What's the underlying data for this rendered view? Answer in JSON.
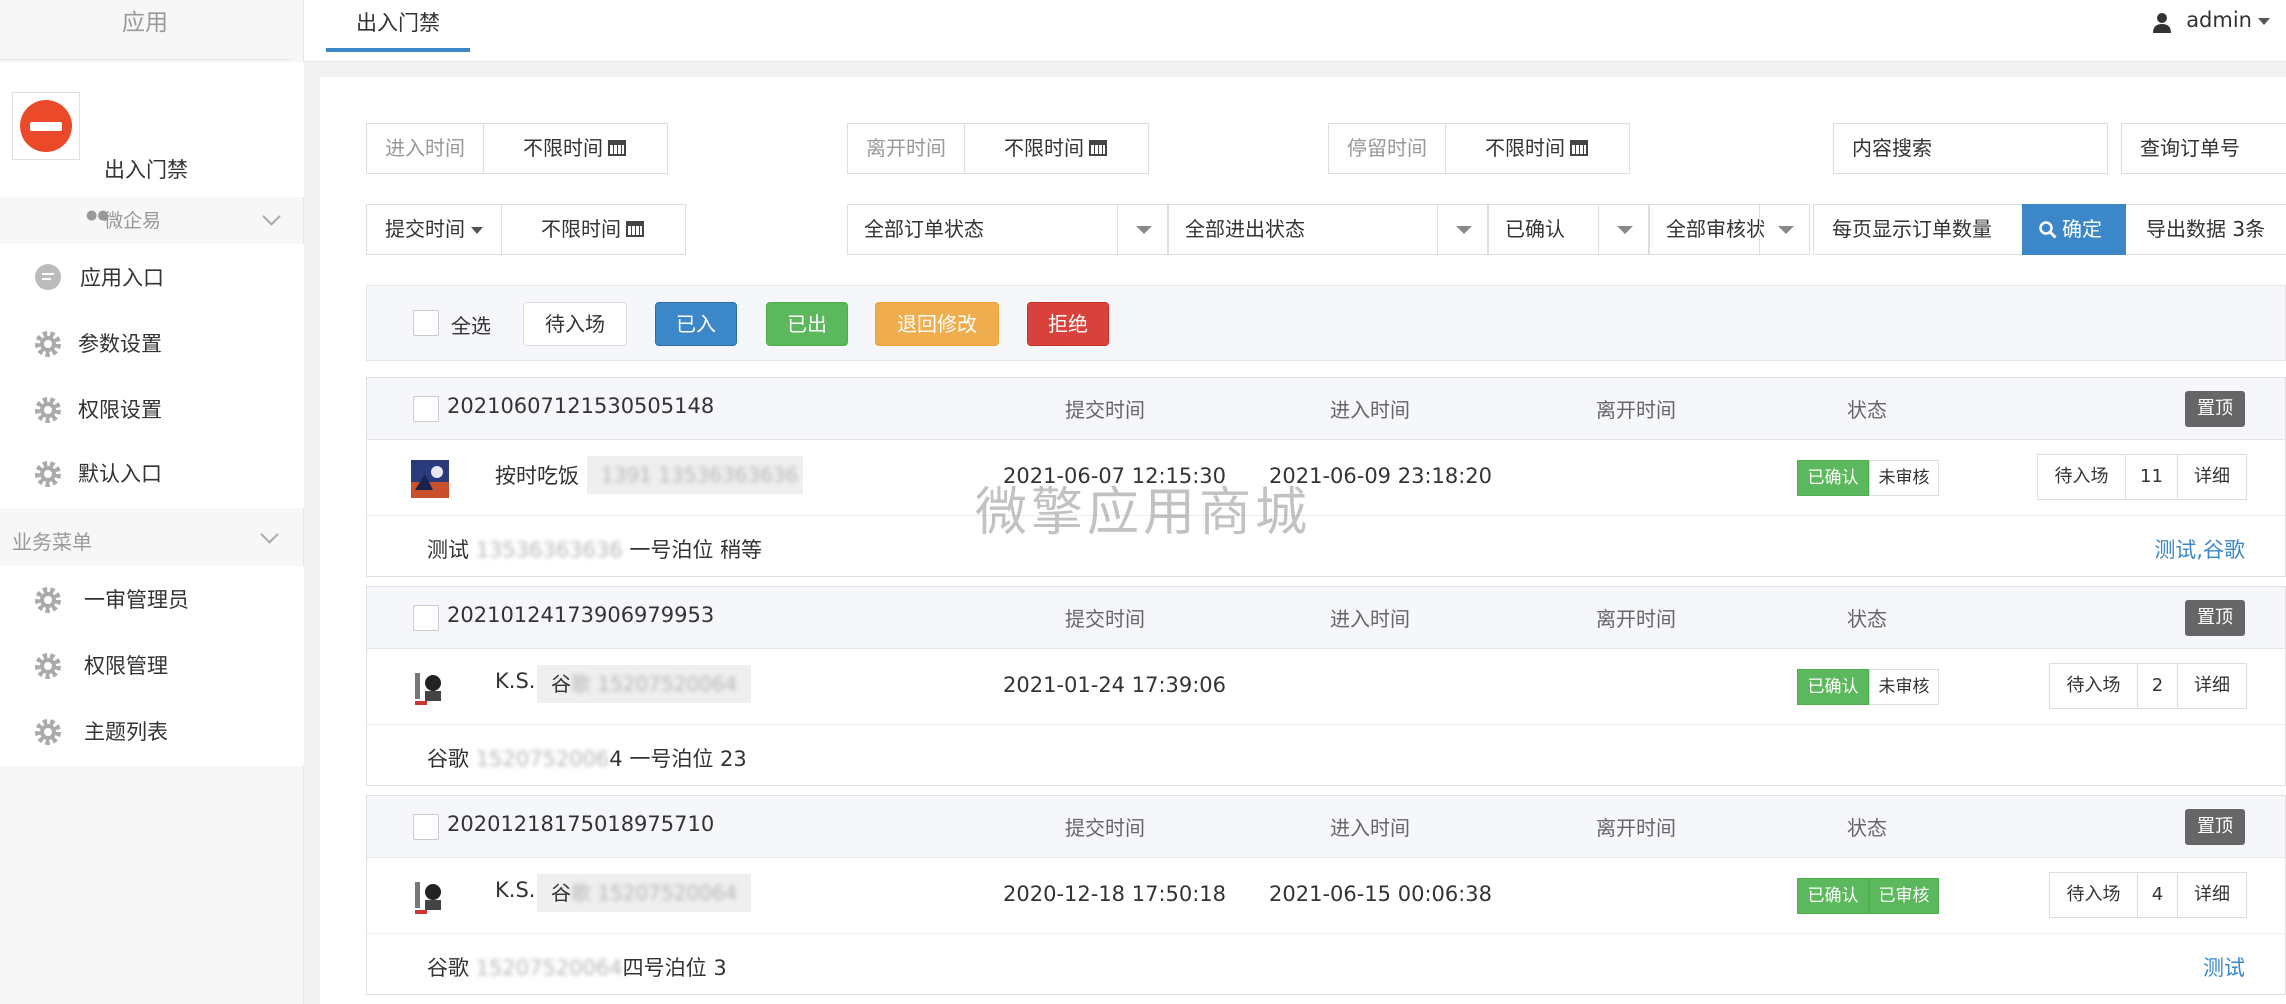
{
  "sidebar": {
    "title": "应用",
    "module": {
      "name": "出入门禁",
      "logo_icon": "no-entry-icon"
    },
    "group1": {
      "label": "微企易"
    },
    "group1_items": [
      {
        "label": "应用入口",
        "icon": "chat-bubble-icon"
      },
      {
        "label": "参数设置",
        "icon": "gear-icon"
      },
      {
        "label": "权限设置",
        "icon": "gear-icon"
      },
      {
        "label": "默认入口",
        "icon": "gear-icon"
      }
    ],
    "group2": {
      "label": "业务菜单"
    },
    "group2_items": [
      {
        "label": "一审管理员",
        "icon": "gear-icon"
      },
      {
        "label": "权限管理",
        "icon": "gear-icon"
      },
      {
        "label": "主题列表",
        "icon": "gear-icon"
      }
    ]
  },
  "topbar": {
    "tab": "出入门禁",
    "user": "admin"
  },
  "filters": {
    "enter_time": {
      "label": "进入时间",
      "value": "不限时间"
    },
    "leave_time": {
      "label": "离开时间",
      "value": "不限时间"
    },
    "stay_time": {
      "label": "停留时间",
      "value": "不限时间"
    },
    "content_search_placeholder": "内容搜索",
    "order_search_placeholder": "查询订单号",
    "submit_time": {
      "label": "提交时间",
      "value": "不限时间"
    },
    "order_status": "全部订单状态",
    "inout_status": "全部进出状态",
    "confirm_status": "已确认",
    "review_status": "全部审核状态",
    "page_size_placeholder": "每页显示订单数量",
    "confirm_button": "确定",
    "export_label": "导出数据 3条"
  },
  "actions": {
    "select_all": "全选",
    "pending": "待入场",
    "entered": "已入",
    "exited": "已出",
    "returned": "退回修改",
    "reject": "拒绝"
  },
  "columns": {
    "submit": "提交时间",
    "enter": "进入时间",
    "leave": "离开时间",
    "status": "状态",
    "pin": "置顶"
  },
  "orders": [
    {
      "id": "20210607121530505148",
      "name": "按时吃饭",
      "contact": "1391 13536363636",
      "submit_time": "2021-06-07 12:15:30",
      "enter_time": "2021-06-09 23:18:20",
      "leave_time": "",
      "status1": "已确认",
      "status2": "未审核",
      "action": "待入场",
      "count": "11",
      "detail": "详细",
      "note_pre": "测试",
      "note_blur": "13536363636",
      "note_post": "一号泊位 稍等",
      "tags": "测试,谷歌"
    },
    {
      "id": "20210124173906979953",
      "name": "K.S.",
      "contact_pre": "谷",
      "contact": "歌 15207520064",
      "submit_time": "2021-01-24 17:39:06",
      "enter_time": "",
      "leave_time": "",
      "status1": "已确认",
      "status2": "未审核",
      "action": "待入场",
      "count": "2",
      "detail": "详细",
      "note_pre": "谷歌",
      "note_blur": "1520752006",
      "note_post": "4 一号泊位 23",
      "tags": ""
    },
    {
      "id": "20201218175018975710",
      "name": "K.S.",
      "contact_pre": "谷",
      "contact": "歌 15207520064",
      "submit_time": "2020-12-18 17:50:18",
      "enter_time": "2021-06-15 00:06:38",
      "leave_time": "",
      "status1": "已确认",
      "status2": "已审核",
      "action": "待入场",
      "count": "4",
      "detail": "详细",
      "note_pre": "谷歌",
      "note_blur": "15207520064",
      "note_post": "四号泊位 3",
      "tags": "测试"
    }
  ],
  "watermark": "微擎应用商城",
  "colors": {
    "primary": "#3b87c8",
    "success": "#5cb85c",
    "warning": "#f0ad4e",
    "danger": "#d9413c"
  }
}
